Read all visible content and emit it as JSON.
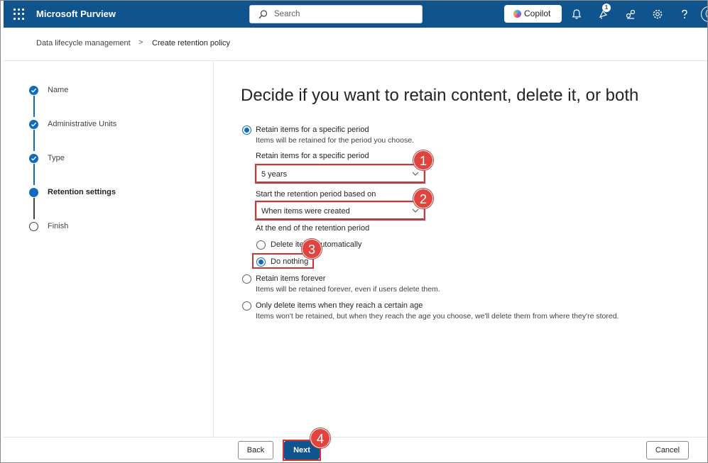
{
  "topbar": {
    "app_name": "Microsoft Purview",
    "search_placeholder": "Search",
    "copilot_label": "Copilot",
    "notification_count": "1",
    "avatar_initial": "(",
    "bg_color": "#0f548c"
  },
  "breadcrumb": {
    "parent": "Data lifecycle management",
    "separator": ">",
    "current": "Create retention policy"
  },
  "wizard": {
    "steps": [
      {
        "label": "Name",
        "state": "done"
      },
      {
        "label": "Administrative Units",
        "state": "done"
      },
      {
        "label": "Type",
        "state": "done"
      },
      {
        "label": "Retention settings",
        "state": "current"
      },
      {
        "label": "Finish",
        "state": "todo"
      }
    ]
  },
  "main": {
    "title": "Decide if you want to retain content, delete it, or both",
    "option_specific": {
      "label": "Retain items for a specific period",
      "desc": "Items will be retained for the period you choose.",
      "selected": true
    },
    "period_field": {
      "label": "Retain items for a specific period",
      "value": "5 years"
    },
    "start_field": {
      "label": "Start the retention period based on",
      "value": "When items were created"
    },
    "end_section": {
      "label": "At the end of the retention period",
      "delete_label": "Delete items automatically",
      "nothing_label": "Do nothing",
      "selected": "nothing"
    },
    "option_forever": {
      "label": "Retain items forever",
      "desc": "Items will be retained forever, even if users delete them."
    },
    "option_delete_only": {
      "label": "Only delete items when they reach a certain age",
      "desc": "Items won't be retained, but when they reach the age you choose, we'll delete them from where they're stored."
    }
  },
  "annotations": {
    "marker_1": "1",
    "marker_2": "2",
    "marker_3": "3",
    "marker_4": "4",
    "color": "#d13438"
  },
  "footer": {
    "back_label": "Back",
    "next_label": "Next",
    "cancel_label": "Cancel"
  }
}
